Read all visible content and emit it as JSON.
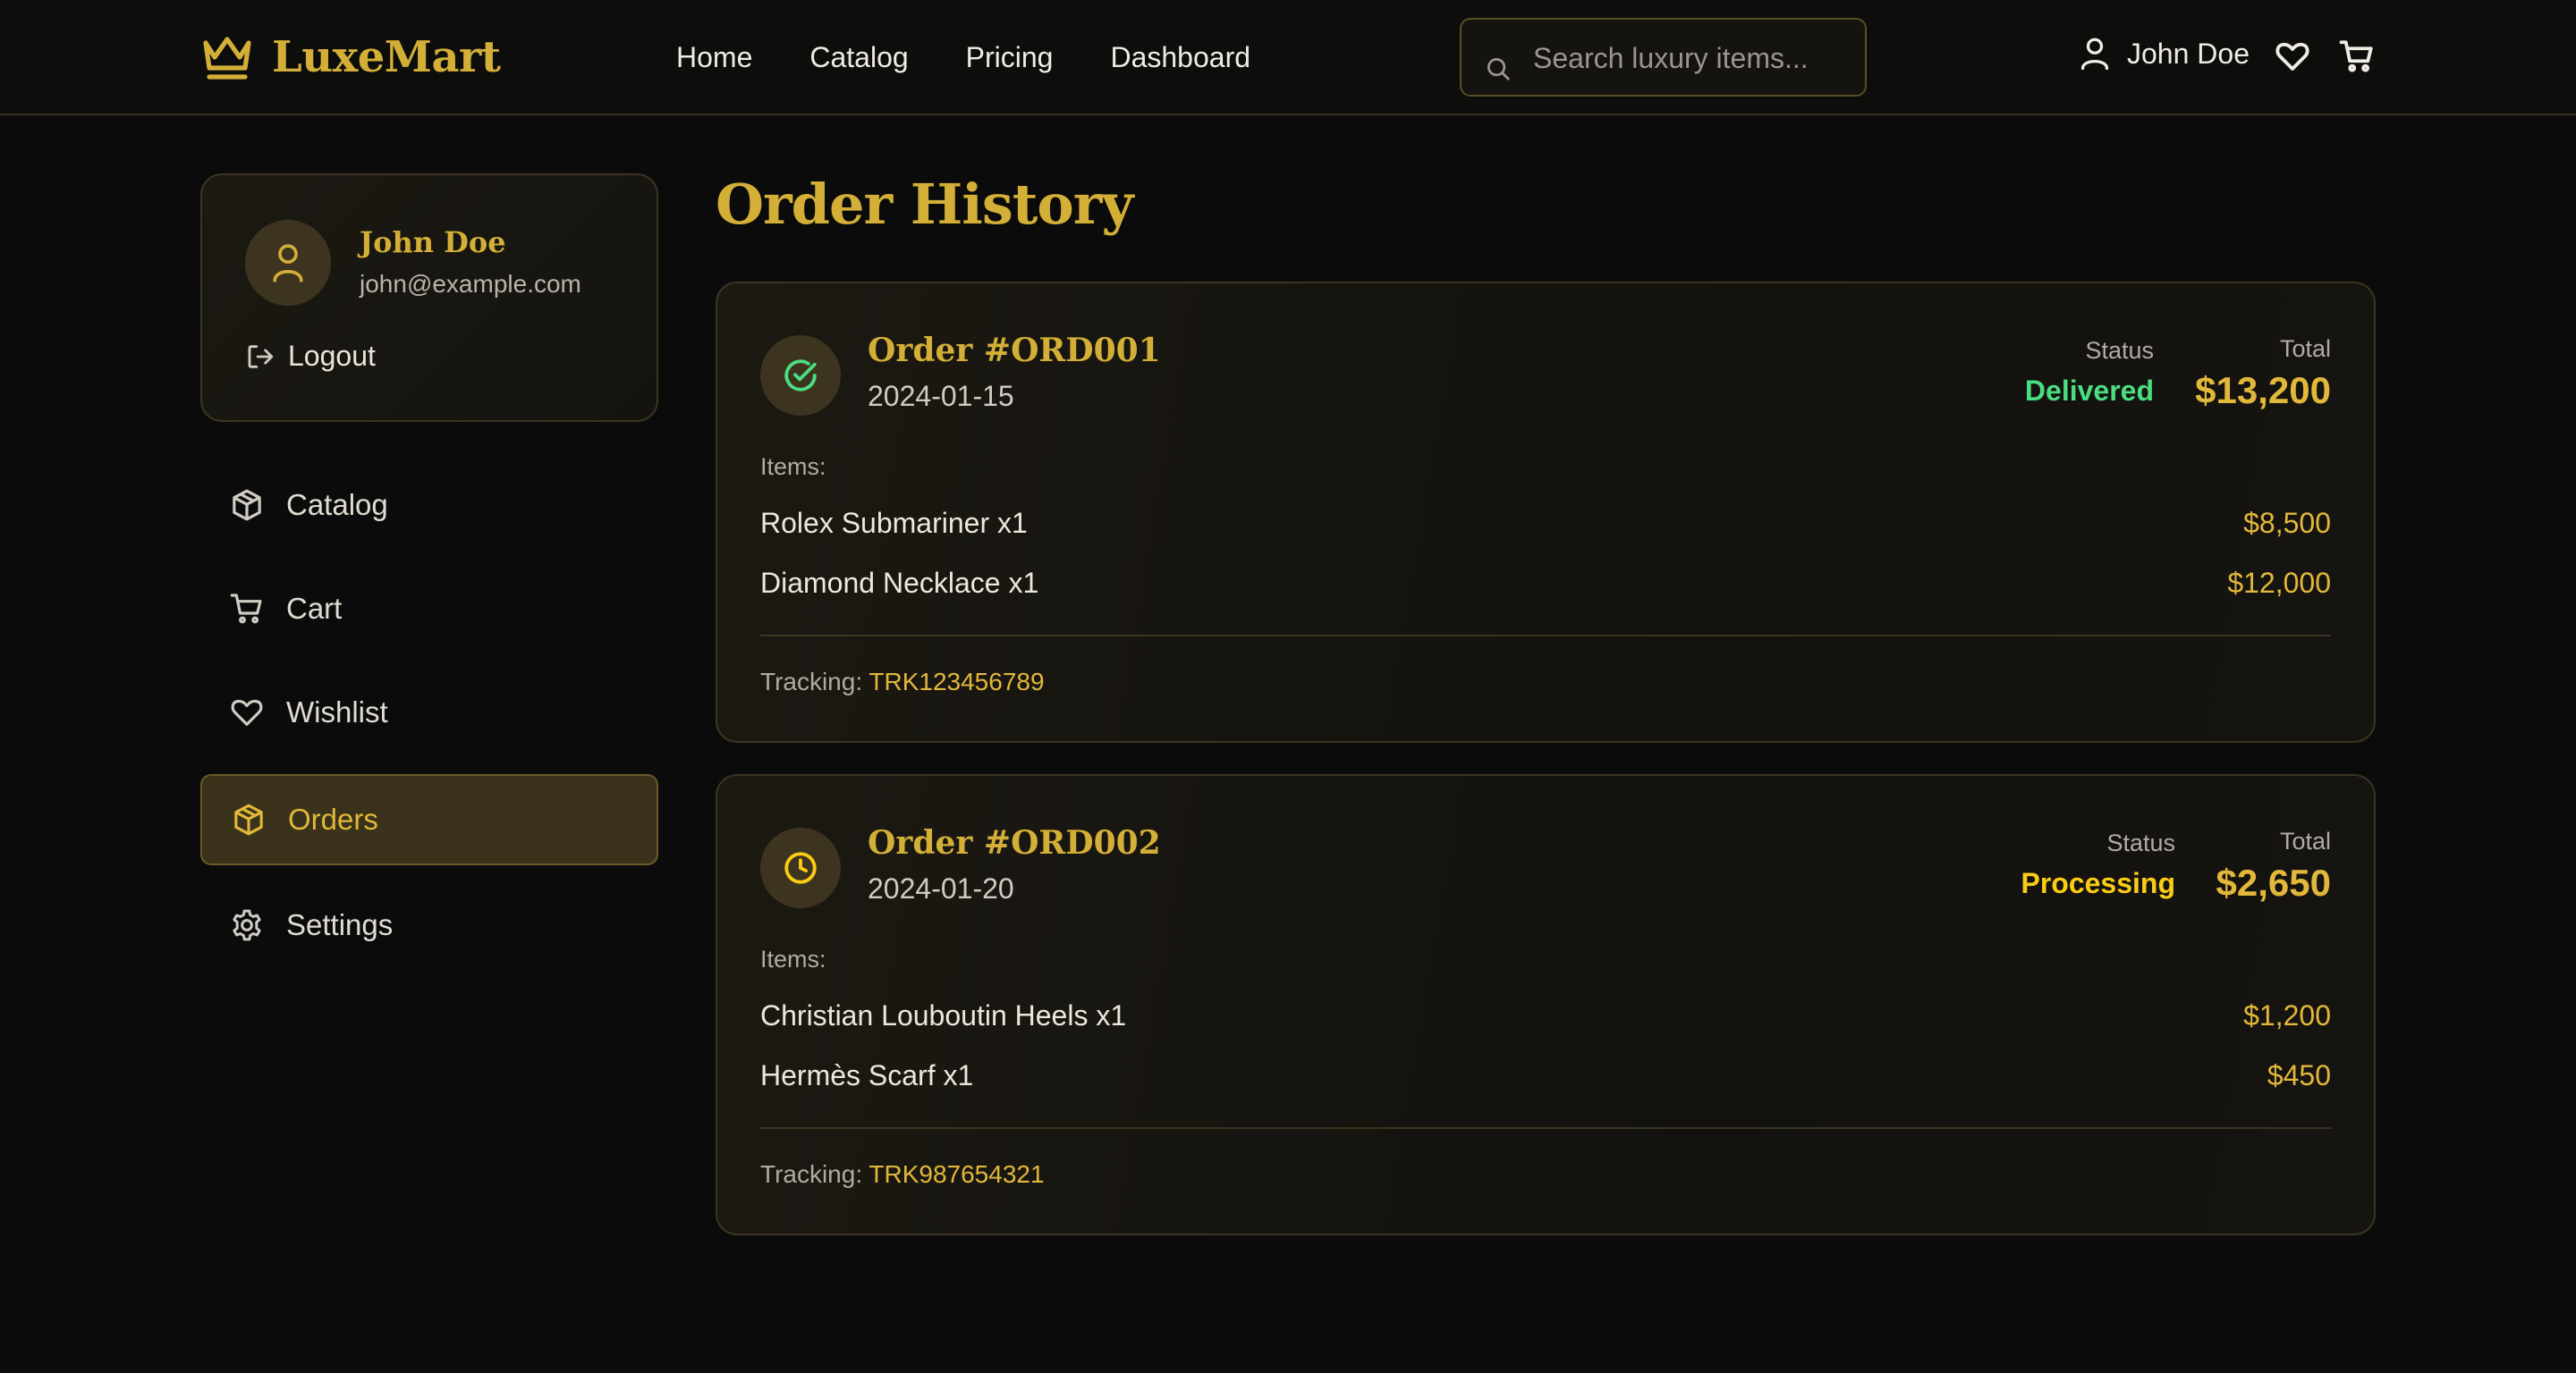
{
  "brand": {
    "name": "LuxeMart",
    "logo_icon": "crown-icon",
    "accent": "#d4af37"
  },
  "nav": [
    {
      "label": "Home"
    },
    {
      "label": "Catalog"
    },
    {
      "label": "Pricing"
    },
    {
      "label": "Dashboard"
    }
  ],
  "search": {
    "placeholder": "Search luxury items...",
    "value": ""
  },
  "header_user": {
    "name": "John Doe"
  },
  "profile": {
    "name": "John Doe",
    "email": "john@example.com",
    "logout_label": "Logout"
  },
  "sidebar": {
    "items": [
      {
        "label": "Catalog",
        "icon": "package-icon",
        "active": false
      },
      {
        "label": "Cart",
        "icon": "cart-icon",
        "active": false
      },
      {
        "label": "Wishlist",
        "icon": "heart-icon",
        "active": false
      },
      {
        "label": "Orders",
        "icon": "package-icon",
        "active": true
      },
      {
        "label": "Settings",
        "icon": "gear-icon",
        "active": false
      }
    ]
  },
  "page": {
    "title": "Order History"
  },
  "orders": [
    {
      "id": "Order #ORD001",
      "date": "2024-01-15",
      "status_label": "Status",
      "status": "Delivered",
      "status_color": "#4ade80",
      "status_icon": "check-circle-icon",
      "total_label": "Total",
      "total": "$13,200",
      "items_label": "Items:",
      "items": [
        {
          "name": "Rolex Submariner x1",
          "price": "$8,500"
        },
        {
          "name": "Diamond Necklace x1",
          "price": "$12,000"
        }
      ],
      "tracking_label": "Tracking:",
      "tracking": "TRK123456789"
    },
    {
      "id": "Order #ORD002",
      "date": "2024-01-20",
      "status_label": "Status",
      "status": "Processing",
      "status_color": "#facc15",
      "status_icon": "clock-icon",
      "total_label": "Total",
      "total": "$2,650",
      "items_label": "Items:",
      "items": [
        {
          "name": "Christian Louboutin Heels x1",
          "price": "$1,200"
        },
        {
          "name": "Hermès Scarf x1",
          "price": "$450"
        }
      ],
      "tracking_label": "Tracking:",
      "tracking": "TRK987654321"
    }
  ]
}
